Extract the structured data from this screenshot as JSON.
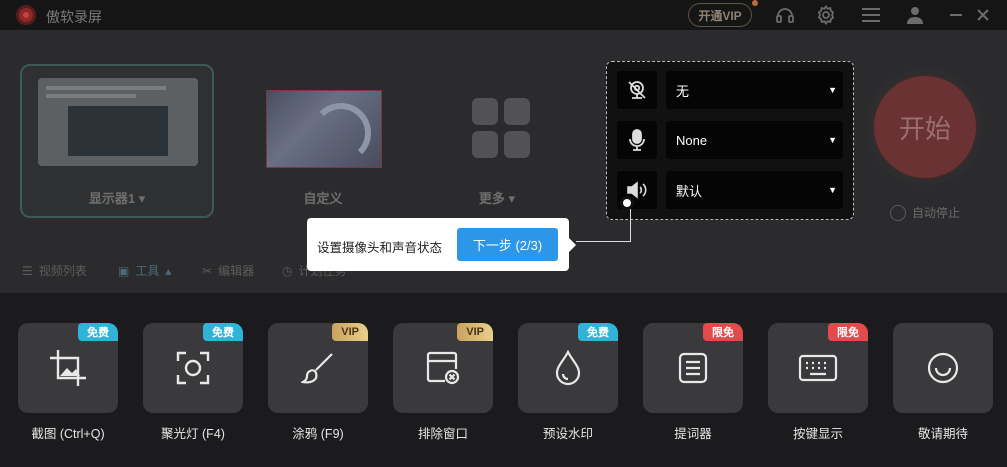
{
  "titlebar": {
    "app_title": "傲软录屏",
    "vip_label": "开通VIP"
  },
  "modes": {
    "display_label": "显示器1 ▾",
    "custom_label": "自定义",
    "more_label": "更多 ▾"
  },
  "av": {
    "camera_value": "无",
    "mic_value": "None",
    "speaker_value": "默认"
  },
  "start": {
    "label": "开始",
    "auto_stop_label": "自动停止"
  },
  "subnav": {
    "video_list": "视频列表",
    "tools": "工具",
    "editor": "编辑器",
    "task": "计划任务"
  },
  "tooltip": {
    "text": "设置摄像头和声音状态",
    "next_label": "下一步 (2/3)"
  },
  "tools": [
    {
      "label": "截图 (Ctrl+Q)",
      "badge": "免费",
      "badge_type": "free",
      "icon": "crop-icon"
    },
    {
      "label": "聚光灯 (F4)",
      "badge": "免费",
      "badge_type": "free",
      "icon": "spotlight-icon"
    },
    {
      "label": "涂鸦 (F9)",
      "badge": "VIP",
      "badge_type": "vip",
      "icon": "brush-icon"
    },
    {
      "label": "排除窗口",
      "badge": "VIP",
      "badge_type": "vip",
      "icon": "exclude-window-icon"
    },
    {
      "label": "预设水印",
      "badge": "免费",
      "badge_type": "free",
      "icon": "watermark-drop-icon"
    },
    {
      "label": "提词器",
      "badge": "限免",
      "badge_type": "limited",
      "icon": "teleprompter-icon"
    },
    {
      "label": "按键显示",
      "badge": "限免",
      "badge_type": "limited",
      "icon": "keyboard-icon"
    },
    {
      "label": "敬请期待",
      "badge": "",
      "badge_type": "",
      "icon": "coming-soon-icon"
    }
  ],
  "colors": {
    "accent_blue": "#2c96e8",
    "badge_free": "#2fb3d8",
    "badge_limited": "#e24b4b",
    "badge_vip": "#d9b56e"
  }
}
